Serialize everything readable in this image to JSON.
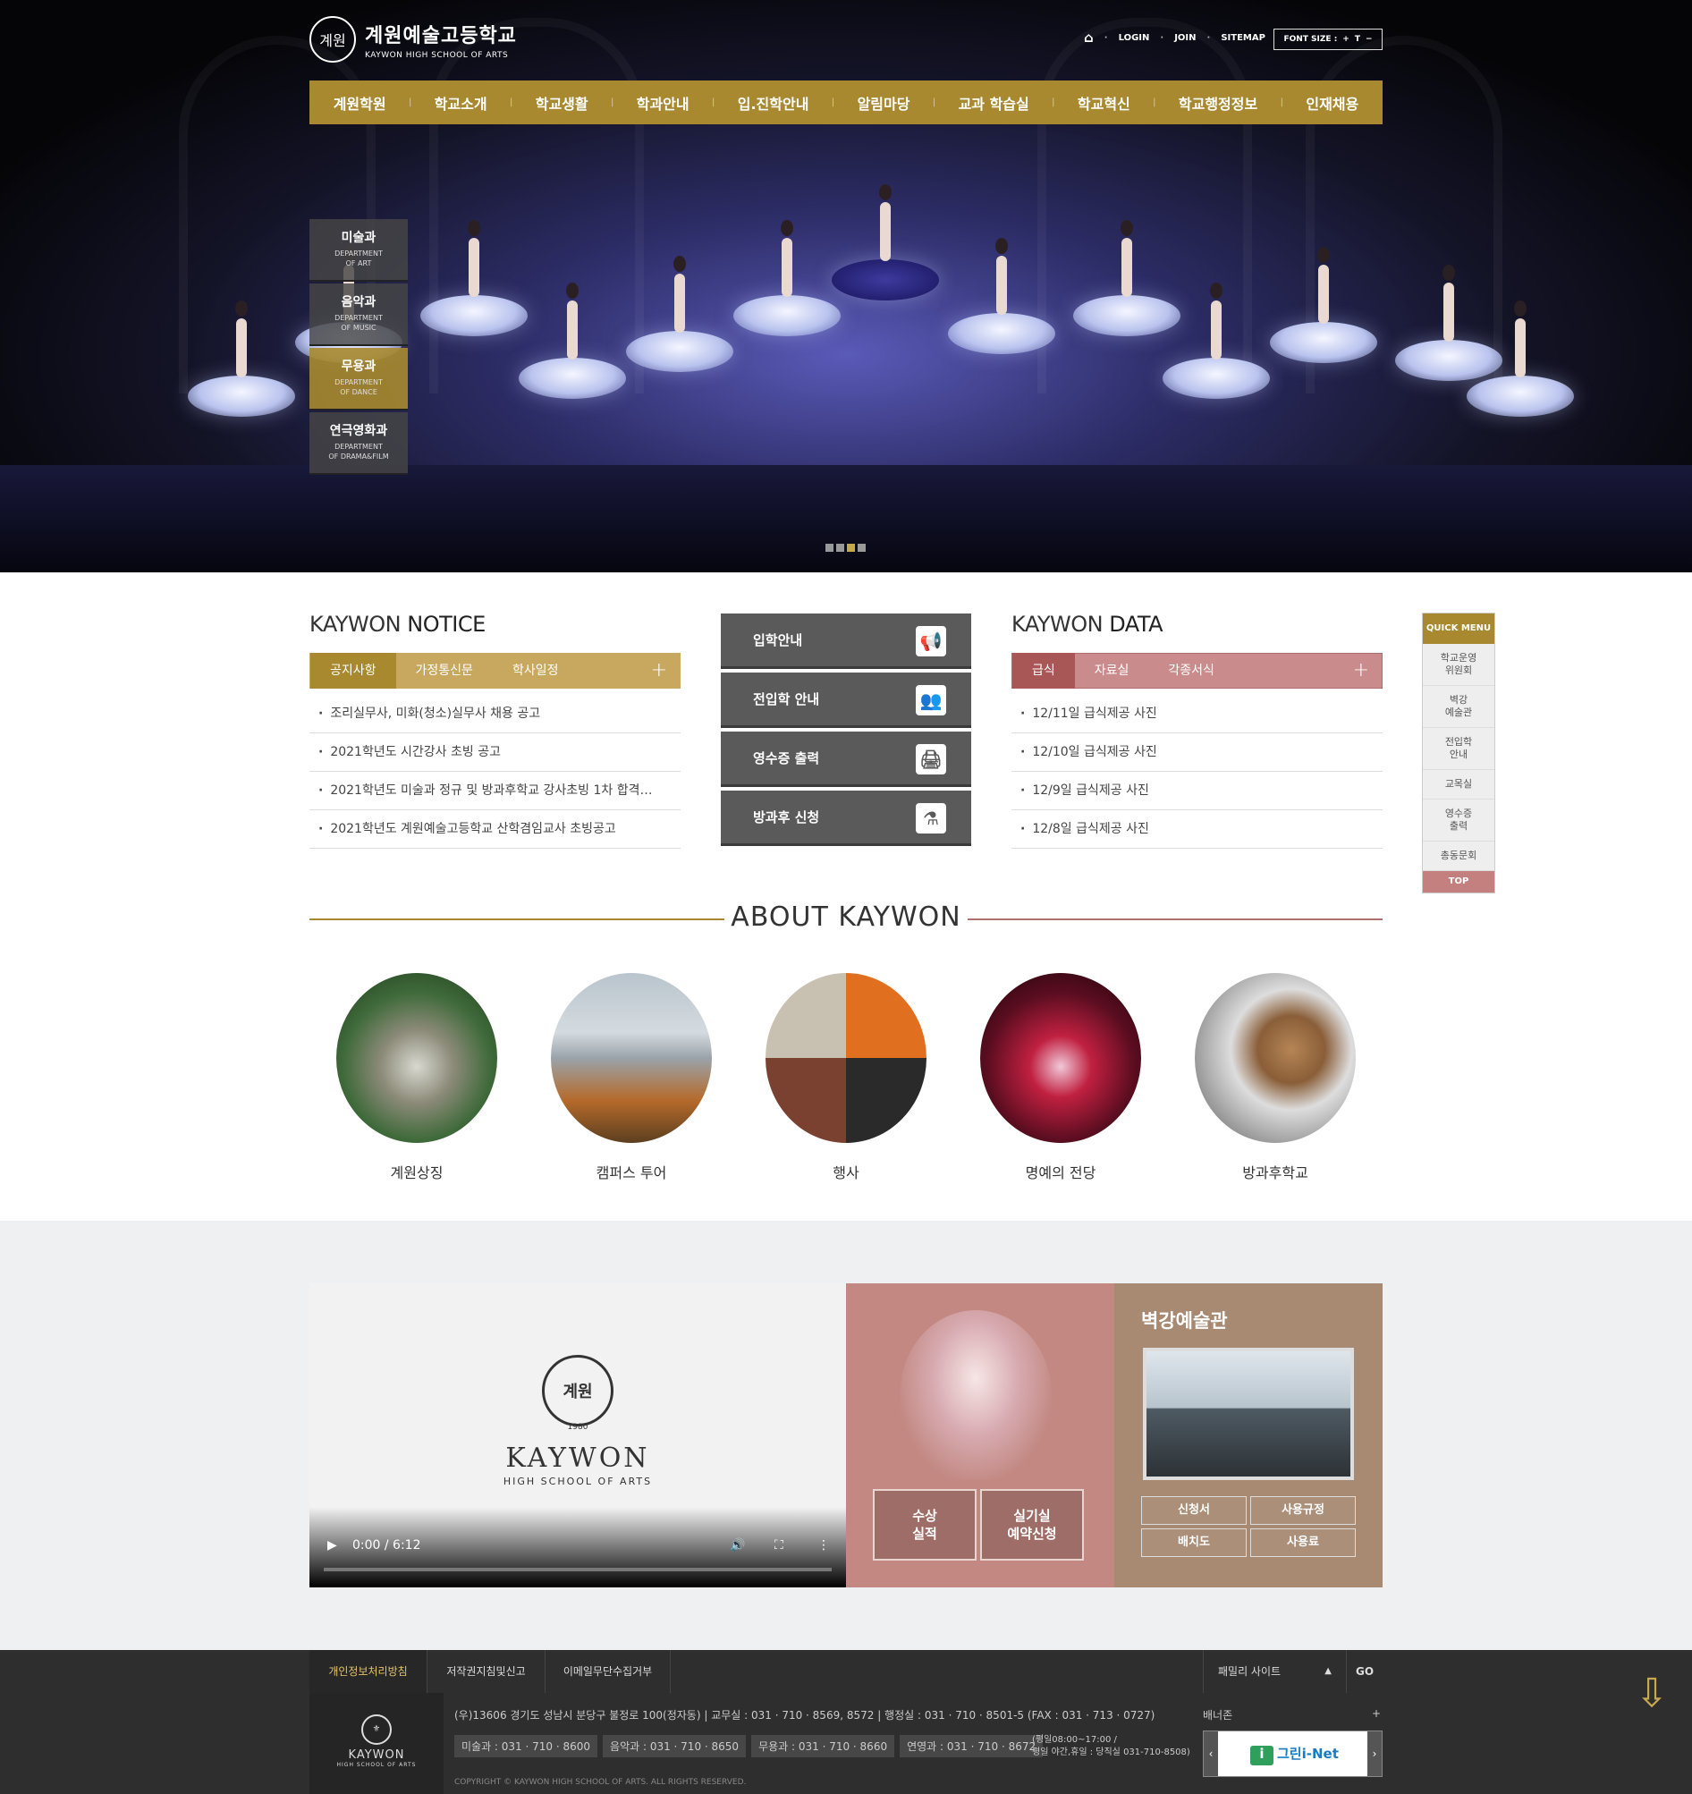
{
  "header": {
    "logo_kr": "계원예술고등학교",
    "logo_en": "KAYWON HIGH SCHOOL OF ARTS",
    "logo_emblem": "계원",
    "util": {
      "login": "LOGIN",
      "join": "JOIN",
      "sitemap": "SITEMAP",
      "font_size": "FONT SIZE :",
      "plus": "+",
      "reset": "T",
      "minus": "−"
    }
  },
  "gnb": [
    "계원학원",
    "학교소개",
    "학교생활",
    "학과안내",
    "입.진학안내",
    "알림마당",
    "교과 학습실",
    "학교혁신",
    "학교행정정보",
    "인재채용"
  ],
  "departments": [
    {
      "kr": "미술과",
      "en1": "DEPARTMENT",
      "en2": "OF ART"
    },
    {
      "kr": "음악과",
      "en1": "DEPARTMENT",
      "en2": "OF MUSIC"
    },
    {
      "kr": "무용과",
      "en1": "DEPARTMENT",
      "en2": "OF DANCE"
    },
    {
      "kr": "연극영화과",
      "en1": "DEPARTMENT",
      "en2": "OF DRAMA&FILM"
    }
  ],
  "notice": {
    "title_light": "KAYWON ",
    "title_bold": "NOTICE",
    "tabs": [
      "공지사항",
      "가정통신문",
      "학사일정"
    ],
    "items": [
      "조리실무사, 미화(청소)실무사 채용 공고",
      "2021학년도 시간강사 초빙 공고",
      "2021학년도 미술과 정규 및 방과후학교 강사초빙 1차 합격…",
      "2021학년도 계원예술고등학교 산학겸임교사 초빙공고"
    ]
  },
  "quick_buttons": [
    {
      "label": "입학안내",
      "icon": "megaphone-icon",
      "glyph": "📢"
    },
    {
      "label": "전입학 안내",
      "icon": "people-icon",
      "glyph": "👥"
    },
    {
      "label": "영수증 출력",
      "icon": "printer-icon",
      "glyph": "🖨"
    },
    {
      "label": "방과후 신청",
      "icon": "flask-icon",
      "glyph": "⚗"
    }
  ],
  "data": {
    "title_light": "KAYWON ",
    "title_bold": "DATA",
    "tabs": [
      "급식",
      "자료실",
      "각종서식"
    ],
    "items": [
      "12/11일 급식제공 사진",
      "12/10일 급식제공 사진",
      "12/9일 급식제공 사진",
      "12/8일 급식제공 사진"
    ]
  },
  "quick_menu": {
    "header": "QUICK MENU",
    "items": [
      "학교운영\n위원회",
      "벽강\n예술관",
      "전입학\n안내",
      "교목실",
      "영수증\n출력",
      "총동문회"
    ],
    "top": "TOP"
  },
  "about": {
    "title_light": "ABOUT ",
    "title_bold": "KAYWON",
    "items": [
      "계원상징",
      "캠퍼스 투어",
      "행사",
      "명예의 전당",
      "방과후학교"
    ]
  },
  "video": {
    "emblem": "계원",
    "year": "1980",
    "name": "KAYWON",
    "sub": "HIGH SCHOOL OF ARTS",
    "time": "0:00 / 6:12"
  },
  "award": {
    "btn1": "수상\n실적",
    "btn2": "실기실\n예약신청"
  },
  "hall": {
    "title": "벽강예술관",
    "buttons": [
      "신청서",
      "사용규정",
      "배치도",
      "사용료"
    ]
  },
  "footer": {
    "tabs": [
      "개인정보처리방침",
      "저작권지침및신고",
      "이메일무단수집거부"
    ],
    "family": "패밀리 사이트",
    "go": "GO",
    "logo_name": "KAYWON",
    "logo_sub": "HIGH SCHOOL OF ARTS",
    "address": "(우)13606 경기도 성남시 분당구 불정로 100(정자동)   |   교무실 : 031 · 710 · 8569, 8572   |   행정실 : 031 · 710 · 8501-5 (FAX : 031 · 713 · 0727)",
    "phones": [
      "미술과 : 031 · 710 · 8600",
      "음악과 : 031 · 710 · 8650",
      "무용과 : 031 · 710 · 8660",
      "연영과 : 031 · 710 · 8672"
    ],
    "hours1": "(평일08:00~17:00 /",
    "hours2": "평일 야간,휴일 : 당직실 031-710-8508)",
    "copyright": "COPYRIGHT © KAYWON HIGH SCHOOL OF ARTS. ALL RIGHTS RESERVED.",
    "banner_label": "배너존",
    "banner_text": "그린i-Net"
  },
  "colors": {
    "gold": "#a8892f",
    "rose": "#c28881",
    "taupe": "#a88a72",
    "footer": "#2e2e2e"
  }
}
